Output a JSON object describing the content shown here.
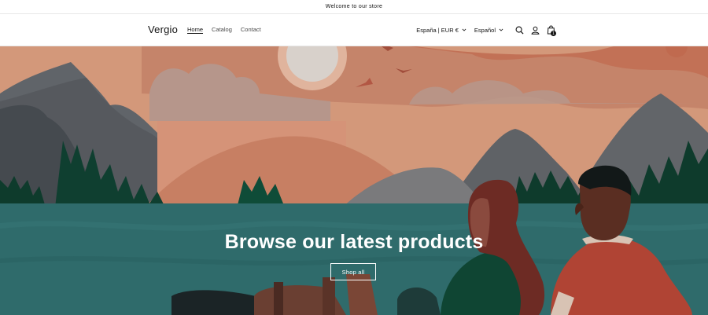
{
  "announcement": {
    "text": "Welcome to our store"
  },
  "header": {
    "logo": "Vergio",
    "nav": [
      {
        "label": "Home",
        "active": true
      },
      {
        "label": "Catalog",
        "active": false
      },
      {
        "label": "Contact",
        "active": false
      }
    ],
    "country_selector": "España | EUR €",
    "language_selector": "Español",
    "icons": [
      "search-icon",
      "account-icon",
      "cart-icon"
    ],
    "cart_count": "1"
  },
  "hero": {
    "title": "Browse our latest products",
    "button_label": "Shop all"
  },
  "colors": {
    "sky": "#d3987a",
    "water": "#2f6b6b",
    "text_light": "#ffffff",
    "foreground": "#121212"
  }
}
